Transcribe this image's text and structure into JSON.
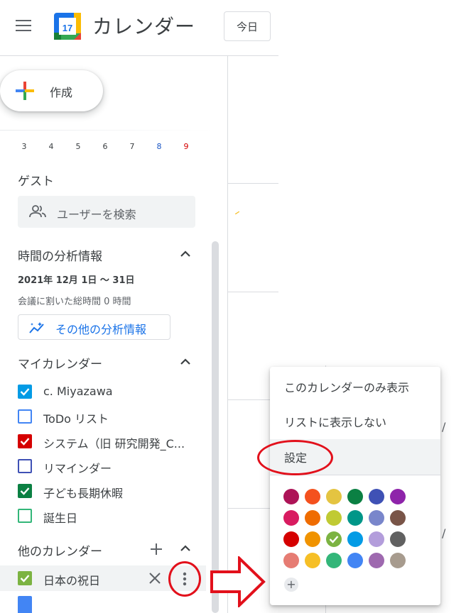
{
  "header": {
    "app_title": "カレンダー",
    "logo_day": "17",
    "today_label": "今日"
  },
  "sidebar": {
    "create_label": "作成",
    "mini_calendar_days": [
      {
        "label": "3",
        "color": "#3c4043"
      },
      {
        "label": "4",
        "color": "#3c4043"
      },
      {
        "label": "5",
        "color": "#3c4043"
      },
      {
        "label": "6",
        "color": "#3c4043"
      },
      {
        "label": "7",
        "color": "#3c4043"
      },
      {
        "label": "8",
        "color": "#1a56c4"
      },
      {
        "label": "9",
        "color": "#d50000"
      }
    ],
    "guests": {
      "title": "ゲスト",
      "search_placeholder": "ユーザーを検索"
    },
    "insights": {
      "title": "時間の分析情報",
      "date_range": "2021年 12月 1日 〜 31日",
      "meeting_time": "会議に割いた総時間 0 時間",
      "more_label": "その他の分析情報"
    },
    "my_calendars": {
      "title": "マイカレンダー",
      "items": [
        {
          "label": "c. Miyazawa",
          "color": "#039be5",
          "checked": true
        },
        {
          "label": "ToDo リスト",
          "color": "#4285f4",
          "checked": false
        },
        {
          "label": "システム（旧 研究開発_C...",
          "color": "#d50000",
          "checked": true
        },
        {
          "label": "リマインダー",
          "color": "#3f51b5",
          "checked": false
        },
        {
          "label": "子ども長期休暇",
          "color": "#0b8043",
          "checked": true
        },
        {
          "label": "誕生日",
          "color": "#33b679",
          "checked": false
        }
      ]
    },
    "other_calendars": {
      "title": "他のカレンダー",
      "items": [
        {
          "label": "日本の祝日",
          "color": "#7cb342",
          "checked": true
        }
      ]
    }
  },
  "menu": {
    "items": [
      {
        "label": "このカレンダーのみ表示",
        "highlighted": false
      },
      {
        "label": "リストに表示しない",
        "highlighted": false
      },
      {
        "label": "設定",
        "highlighted": true
      }
    ],
    "colors": [
      [
        "#ad1457",
        "#f4511e",
        "#e4c441",
        "#0b8043",
        "#3f51b5",
        "#8e24aa"
      ],
      [
        "#d81b60",
        "#ef6c00",
        "#c0ca33",
        "#009688",
        "#7986cb",
        "#795548"
      ],
      [
        "#d50000",
        "#f09300",
        "#7cb342",
        "#039be5",
        "#b39ddb",
        "#616161"
      ],
      [
        "#e67c73",
        "#f6bf26",
        "#33b679",
        "#4285f4",
        "#9e69af",
        "#a79b8e"
      ]
    ],
    "selected_color": "#7cb342",
    "add_color_label": "+"
  },
  "annotation_color": "#e2101b"
}
